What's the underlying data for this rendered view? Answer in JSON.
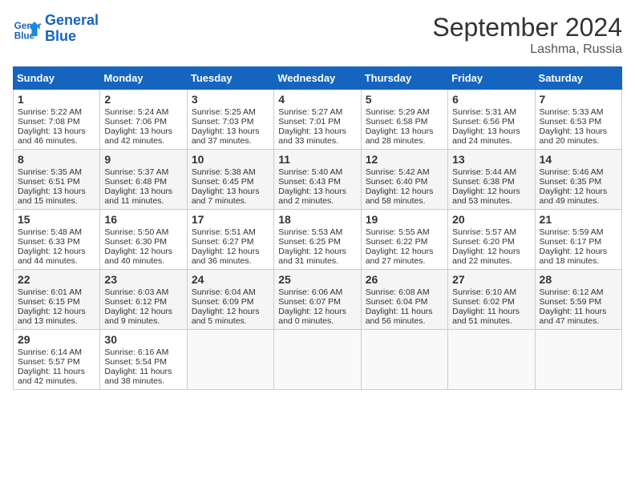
{
  "header": {
    "logo_line1": "General",
    "logo_line2": "Blue",
    "month_title": "September 2024",
    "subtitle": "Lashma, Russia"
  },
  "days_of_week": [
    "Sunday",
    "Monday",
    "Tuesday",
    "Wednesday",
    "Thursday",
    "Friday",
    "Saturday"
  ],
  "weeks": [
    [
      {
        "day": "1",
        "lines": [
          "Sunrise: 5:22 AM",
          "Sunset: 7:08 PM",
          "Daylight: 13 hours",
          "and 46 minutes."
        ]
      },
      {
        "day": "2",
        "lines": [
          "Sunrise: 5:24 AM",
          "Sunset: 7:06 PM",
          "Daylight: 13 hours",
          "and 42 minutes."
        ]
      },
      {
        "day": "3",
        "lines": [
          "Sunrise: 5:25 AM",
          "Sunset: 7:03 PM",
          "Daylight: 13 hours",
          "and 37 minutes."
        ]
      },
      {
        "day": "4",
        "lines": [
          "Sunrise: 5:27 AM",
          "Sunset: 7:01 PM",
          "Daylight: 13 hours",
          "and 33 minutes."
        ]
      },
      {
        "day": "5",
        "lines": [
          "Sunrise: 5:29 AM",
          "Sunset: 6:58 PM",
          "Daylight: 13 hours",
          "and 28 minutes."
        ]
      },
      {
        "day": "6",
        "lines": [
          "Sunrise: 5:31 AM",
          "Sunset: 6:56 PM",
          "Daylight: 13 hours",
          "and 24 minutes."
        ]
      },
      {
        "day": "7",
        "lines": [
          "Sunrise: 5:33 AM",
          "Sunset: 6:53 PM",
          "Daylight: 13 hours",
          "and 20 minutes."
        ]
      }
    ],
    [
      {
        "day": "8",
        "lines": [
          "Sunrise: 5:35 AM",
          "Sunset: 6:51 PM",
          "Daylight: 13 hours",
          "and 15 minutes."
        ]
      },
      {
        "day": "9",
        "lines": [
          "Sunrise: 5:37 AM",
          "Sunset: 6:48 PM",
          "Daylight: 13 hours",
          "and 11 minutes."
        ]
      },
      {
        "day": "10",
        "lines": [
          "Sunrise: 5:38 AM",
          "Sunset: 6:45 PM",
          "Daylight: 13 hours",
          "and 7 minutes."
        ]
      },
      {
        "day": "11",
        "lines": [
          "Sunrise: 5:40 AM",
          "Sunset: 6:43 PM",
          "Daylight: 13 hours",
          "and 2 minutes."
        ]
      },
      {
        "day": "12",
        "lines": [
          "Sunrise: 5:42 AM",
          "Sunset: 6:40 PM",
          "Daylight: 12 hours",
          "and 58 minutes."
        ]
      },
      {
        "day": "13",
        "lines": [
          "Sunrise: 5:44 AM",
          "Sunset: 6:38 PM",
          "Daylight: 12 hours",
          "and 53 minutes."
        ]
      },
      {
        "day": "14",
        "lines": [
          "Sunrise: 5:46 AM",
          "Sunset: 6:35 PM",
          "Daylight: 12 hours",
          "and 49 minutes."
        ]
      }
    ],
    [
      {
        "day": "15",
        "lines": [
          "Sunrise: 5:48 AM",
          "Sunset: 6:33 PM",
          "Daylight: 12 hours",
          "and 44 minutes."
        ]
      },
      {
        "day": "16",
        "lines": [
          "Sunrise: 5:50 AM",
          "Sunset: 6:30 PM",
          "Daylight: 12 hours",
          "and 40 minutes."
        ]
      },
      {
        "day": "17",
        "lines": [
          "Sunrise: 5:51 AM",
          "Sunset: 6:27 PM",
          "Daylight: 12 hours",
          "and 36 minutes."
        ]
      },
      {
        "day": "18",
        "lines": [
          "Sunrise: 5:53 AM",
          "Sunset: 6:25 PM",
          "Daylight: 12 hours",
          "and 31 minutes."
        ]
      },
      {
        "day": "19",
        "lines": [
          "Sunrise: 5:55 AM",
          "Sunset: 6:22 PM",
          "Daylight: 12 hours",
          "and 27 minutes."
        ]
      },
      {
        "day": "20",
        "lines": [
          "Sunrise: 5:57 AM",
          "Sunset: 6:20 PM",
          "Daylight: 12 hours",
          "and 22 minutes."
        ]
      },
      {
        "day": "21",
        "lines": [
          "Sunrise: 5:59 AM",
          "Sunset: 6:17 PM",
          "Daylight: 12 hours",
          "and 18 minutes."
        ]
      }
    ],
    [
      {
        "day": "22",
        "lines": [
          "Sunrise: 6:01 AM",
          "Sunset: 6:15 PM",
          "Daylight: 12 hours",
          "and 13 minutes."
        ]
      },
      {
        "day": "23",
        "lines": [
          "Sunrise: 6:03 AM",
          "Sunset: 6:12 PM",
          "Daylight: 12 hours",
          "and 9 minutes."
        ]
      },
      {
        "day": "24",
        "lines": [
          "Sunrise: 6:04 AM",
          "Sunset: 6:09 PM",
          "Daylight: 12 hours",
          "and 5 minutes."
        ]
      },
      {
        "day": "25",
        "lines": [
          "Sunrise: 6:06 AM",
          "Sunset: 6:07 PM",
          "Daylight: 12 hours",
          "and 0 minutes."
        ]
      },
      {
        "day": "26",
        "lines": [
          "Sunrise: 6:08 AM",
          "Sunset: 6:04 PM",
          "Daylight: 11 hours",
          "and 56 minutes."
        ]
      },
      {
        "day": "27",
        "lines": [
          "Sunrise: 6:10 AM",
          "Sunset: 6:02 PM",
          "Daylight: 11 hours",
          "and 51 minutes."
        ]
      },
      {
        "day": "28",
        "lines": [
          "Sunrise: 6:12 AM",
          "Sunset: 5:59 PM",
          "Daylight: 11 hours",
          "and 47 minutes."
        ]
      }
    ],
    [
      {
        "day": "29",
        "lines": [
          "Sunrise: 6:14 AM",
          "Sunset: 5:57 PM",
          "Daylight: 11 hours",
          "and 42 minutes."
        ]
      },
      {
        "day": "30",
        "lines": [
          "Sunrise: 6:16 AM",
          "Sunset: 5:54 PM",
          "Daylight: 11 hours",
          "and 38 minutes."
        ]
      },
      null,
      null,
      null,
      null,
      null
    ]
  ]
}
